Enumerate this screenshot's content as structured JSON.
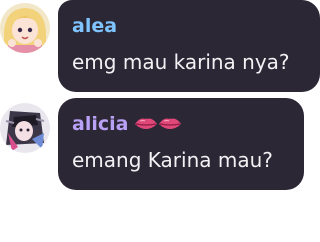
{
  "messages": [
    {
      "username": "alea",
      "username_color": "#7fc4ff",
      "text": "emg mau karina nya?",
      "avatar": "anime-girl-avatar"
    },
    {
      "username": "alicia",
      "username_color": "#b9a1f5",
      "text": "emang Karina mau?",
      "avatar": "anime-character-avatar",
      "badge": "lips-emoji"
    }
  ],
  "colors": {
    "bubble": "#2b2735",
    "message_text": "#f2f2f4",
    "background": "#ffffff"
  }
}
